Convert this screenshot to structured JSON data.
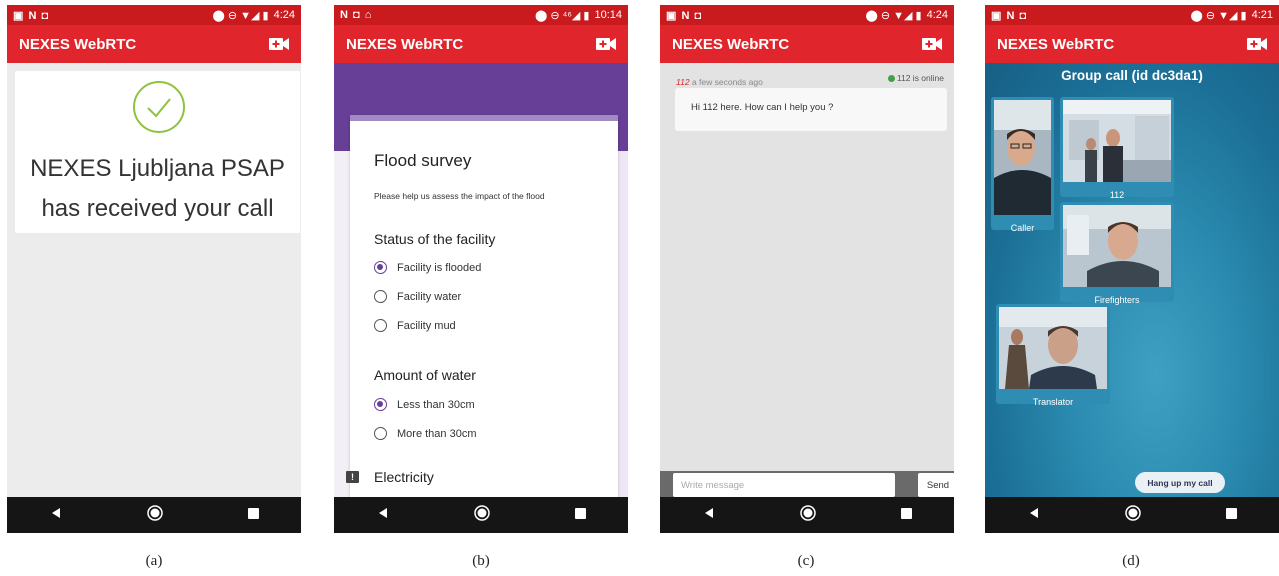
{
  "app_title": "NEXES WebRTC",
  "nav": {
    "back": "◀",
    "home": "◉",
    "recents": "■"
  },
  "captions": [
    "(a)",
    "(b)",
    "(c)",
    "(d)"
  ],
  "colors": {
    "status_bar": "#c91a1e",
    "app_bar": "#e0262c",
    "form_accent": "#673f96",
    "check": "#8fc23d",
    "online_dot": "#43a047",
    "call_bg": "#2b8bb0"
  },
  "screens": {
    "a": {
      "status": {
        "left_icons": "▣ N ◘",
        "right_icons": "⬤ ⊖ ▼◢ ▮",
        "time": "4:24"
      },
      "psap_line1": "NEXES Ljubljana PSAP",
      "psap_line2": "has received your call"
    },
    "b": {
      "status": {
        "left_icons": "N ◘ ⌂",
        "right_icons": "⬤ ⊖ ⁴⁶◢ ▮",
        "time": "10:14"
      },
      "form_title": "Flood survey",
      "form_description": "Please help us assess the impact of the flood",
      "questions": [
        {
          "title": "Status of the facility",
          "options": [
            {
              "label": "Facility is flooded",
              "selected": true
            },
            {
              "label": "Facility water",
              "selected": false
            },
            {
              "label": "Facility mud",
              "selected": false
            }
          ]
        },
        {
          "title": "Amount of water",
          "options": [
            {
              "label": "Less than 30cm",
              "selected": true
            },
            {
              "label": "More than 30cm",
              "selected": false
            }
          ]
        }
      ],
      "section_title": "Electricity",
      "section_icon": "!"
    },
    "c": {
      "status": {
        "left_icons": "▣ N ◘",
        "right_icons": "⬤ ⊖ ▼◢ ▮",
        "time": "4:24"
      },
      "online_status": "112 is online",
      "sender": "112",
      "timestamp": "a few seconds ago",
      "message": "Hi 112 here. How can I help you ?",
      "input_placeholder": "Write message",
      "send_label": "Send"
    },
    "d": {
      "status": {
        "left_icons": "▣ N ◘",
        "right_icons": "⬤ ⊖ ▼◢ ▮",
        "time": "4:21"
      },
      "group_title": "Group call (id dc3da1)",
      "participants": [
        "Caller",
        "112",
        "Firefighters",
        "Translator"
      ],
      "hangup_label": "Hang up my call"
    }
  }
}
